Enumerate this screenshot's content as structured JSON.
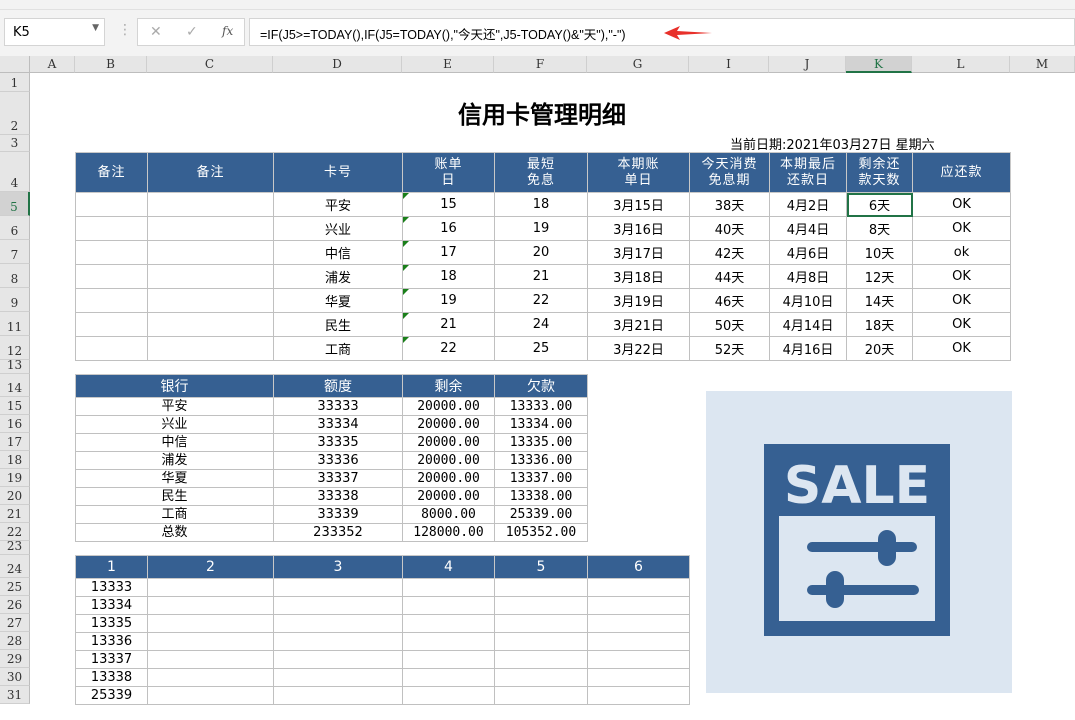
{
  "formula_bar": {
    "name_box": "K5",
    "cancel_icon": "✕",
    "enter_icon": "✓",
    "fx_label": "fx",
    "formula": "=IF(J5>=TODAY(),IF(J5=TODAY(),\"今天还\",J5-TODAY()&\"天\"),\"-\")"
  },
  "columns": [
    "A",
    "B",
    "C",
    "D",
    "E",
    "F",
    "G",
    "I",
    "J",
    "K",
    "L",
    "M"
  ],
  "rows": [
    "1",
    "2",
    "3",
    "4",
    "5",
    "6",
    "7",
    "8",
    "9",
    "11",
    "12",
    "13",
    "14",
    "15",
    "16",
    "17",
    "18",
    "19",
    "20",
    "21",
    "22",
    "23",
    "24",
    "25",
    "26",
    "27",
    "28",
    "29",
    "30",
    "31"
  ],
  "title": "信用卡管理明细",
  "current_date": "当前日期:2021年03月27日  星期六",
  "card_table": {
    "headers": [
      "备注",
      "备注",
      "卡号",
      "账单\n日",
      "最短\n免息",
      "本期账\n单日",
      "今天消费\n免息期",
      "本期最后\n还款日",
      "剩余还\n款天数",
      "应还款"
    ],
    "rows": [
      [
        "",
        "",
        "平安",
        "15",
        "18",
        "3月15日",
        "38天",
        "4月2日",
        "6天",
        "OK"
      ],
      [
        "",
        "",
        "兴业",
        "16",
        "19",
        "3月16日",
        "40天",
        "4月4日",
        "8天",
        "OK"
      ],
      [
        "",
        "",
        "中信",
        "17",
        "20",
        "3月17日",
        "42天",
        "4月6日",
        "10天",
        "ok"
      ],
      [
        "",
        "",
        "浦发",
        "18",
        "21",
        "3月18日",
        "44天",
        "4月8日",
        "12天",
        "OK"
      ],
      [
        "",
        "",
        "华夏",
        "19",
        "22",
        "3月19日",
        "46天",
        "4月10日",
        "14天",
        "OK"
      ],
      [
        "",
        "",
        "民生",
        "21",
        "24",
        "3月21日",
        "50天",
        "4月14日",
        "18天",
        "OK"
      ],
      [
        "",
        "",
        "工商",
        "22",
        "25",
        "3月22日",
        "52天",
        "4月16日",
        "20天",
        "OK"
      ]
    ]
  },
  "credit_table": {
    "headers": [
      "银行",
      "额度",
      "剩余",
      "欠款"
    ],
    "rows": [
      [
        "平安",
        "33333",
        "20000.00",
        "13333.00"
      ],
      [
        "兴业",
        "33334",
        "20000.00",
        "13334.00"
      ],
      [
        "中信",
        "33335",
        "20000.00",
        "13335.00"
      ],
      [
        "浦发",
        "33336",
        "20000.00",
        "13336.00"
      ],
      [
        "华夏",
        "33337",
        "20000.00",
        "13337.00"
      ],
      [
        "民生",
        "33338",
        "20000.00",
        "13338.00"
      ],
      [
        "工商",
        "33339",
        "8000.00",
        "25339.00"
      ],
      [
        "总数",
        "233352",
        "128000.00",
        "105352.00"
      ]
    ]
  },
  "number_table": {
    "headers": [
      "1",
      "2",
      "3",
      "4",
      "5",
      "6"
    ],
    "rows": [
      [
        "13333"
      ],
      [
        "13334"
      ],
      [
        "13335"
      ],
      [
        "13336"
      ],
      [
        "13337"
      ],
      [
        "13338"
      ],
      [
        "25339"
      ]
    ]
  },
  "sale_image": {
    "text": "SALE",
    "bg": "#dce6f1",
    "fg": "#366092"
  },
  "colors": {
    "header_blue": "#366092",
    "selection_green": "#217346"
  }
}
